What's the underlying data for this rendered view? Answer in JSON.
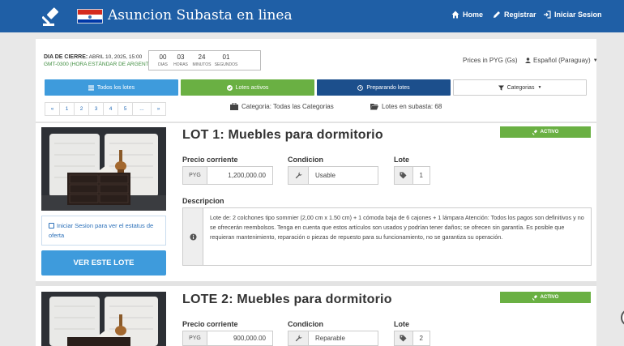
{
  "header": {
    "brand": "Asuncion Subasta en linea",
    "nav": {
      "home": "Home",
      "register": "Registrar",
      "login": "Iniciar Sesion"
    }
  },
  "closing": {
    "label": "DIA DE CIERRE:",
    "date": "ABRIL 10, 2025, 15:00",
    "timezone": "GMT-0300 (HORA ESTÁNDAR DE ARGENTINA)",
    "countdown": [
      {
        "value": "00",
        "unit": "DIAS"
      },
      {
        "value": "03",
        "unit": "HORAS"
      },
      {
        "value": "24",
        "unit": "MINUTOS"
      },
      {
        "value": "01",
        "unit": "SEGUNDOS"
      }
    ]
  },
  "prices_in": "Prices in PYG (Gs)",
  "language": "Español (Paraguay)",
  "filters": {
    "all": "Todos los lotes",
    "active": "Lotes activos",
    "preparing": "Preparando lotes",
    "categories": "Categorias"
  },
  "pager": [
    "«",
    "1",
    "2",
    "3",
    "4",
    "5",
    "...",
    "»"
  ],
  "category_meta": "Categoria: Todas las Categorias",
  "lots_meta": "Lotes en subasta: 68",
  "labels": {
    "price": "Precio corriente",
    "condition": "Condicion",
    "lot": "Lote",
    "description": "Descripcion",
    "currency": "PYG",
    "login_note": "Iniciar Sesion para ver el estatus de oferta",
    "see_lot": "VER ESTE LOTE"
  },
  "lots": [
    {
      "title": "LOT 1: Muebles para dormitorio",
      "status": "ACTIVO",
      "price": "1,200,000.00",
      "condition": "Usable",
      "lot_number": "1",
      "description": "Lote de: 2 colchones tipo sommier (2,00 cm x 1.50 cm) + 1 cómoda baja de 6 cajones + 1 lámpara Atención: Todos los pagos son definitivos y no se ofrecerán reembolsos. Tenga en cuenta que estos artículos son usados y podrían tener daños; se ofrecen sin garantía. Es posible que requieran mantenimiento, reparación o piezas de repuesto para su funcionamiento, no se garantiza su operación."
    },
    {
      "title": "LOTE 2: Muebles para dormitorio",
      "status": "ACTIVO",
      "price": "900,000.00",
      "condition": "Reparable",
      "lot_number": "2"
    }
  ],
  "colors": {
    "header": "#1f5fa6",
    "active_green": "#6ab043",
    "light_blue": "#3e9bdc",
    "dark_blue": "#1c4f8c"
  }
}
